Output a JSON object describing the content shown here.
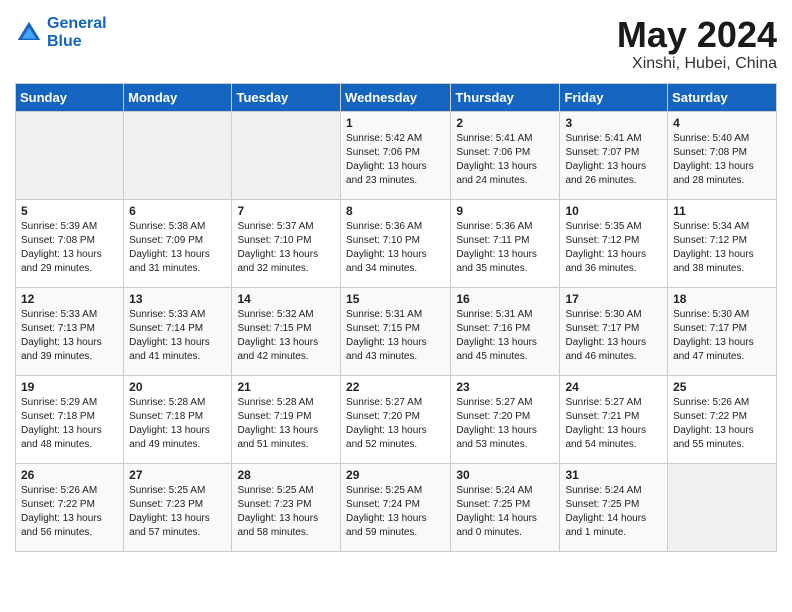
{
  "header": {
    "logo_line1": "General",
    "logo_line2": "Blue",
    "month": "May 2024",
    "location": "Xinshi, Hubei, China"
  },
  "weekdays": [
    "Sunday",
    "Monday",
    "Tuesday",
    "Wednesday",
    "Thursday",
    "Friday",
    "Saturday"
  ],
  "weeks": [
    [
      {
        "day": "",
        "sunrise": "",
        "sunset": "",
        "daylight": ""
      },
      {
        "day": "",
        "sunrise": "",
        "sunset": "",
        "daylight": ""
      },
      {
        "day": "",
        "sunrise": "",
        "sunset": "",
        "daylight": ""
      },
      {
        "day": "1",
        "sunrise": "Sunrise: 5:42 AM",
        "sunset": "Sunset: 7:06 PM",
        "daylight": "Daylight: 13 hours and 23 minutes."
      },
      {
        "day": "2",
        "sunrise": "Sunrise: 5:41 AM",
        "sunset": "Sunset: 7:06 PM",
        "daylight": "Daylight: 13 hours and 24 minutes."
      },
      {
        "day": "3",
        "sunrise": "Sunrise: 5:41 AM",
        "sunset": "Sunset: 7:07 PM",
        "daylight": "Daylight: 13 hours and 26 minutes."
      },
      {
        "day": "4",
        "sunrise": "Sunrise: 5:40 AM",
        "sunset": "Sunset: 7:08 PM",
        "daylight": "Daylight: 13 hours and 28 minutes."
      }
    ],
    [
      {
        "day": "5",
        "sunrise": "Sunrise: 5:39 AM",
        "sunset": "Sunset: 7:08 PM",
        "daylight": "Daylight: 13 hours and 29 minutes."
      },
      {
        "day": "6",
        "sunrise": "Sunrise: 5:38 AM",
        "sunset": "Sunset: 7:09 PM",
        "daylight": "Daylight: 13 hours and 31 minutes."
      },
      {
        "day": "7",
        "sunrise": "Sunrise: 5:37 AM",
        "sunset": "Sunset: 7:10 PM",
        "daylight": "Daylight: 13 hours and 32 minutes."
      },
      {
        "day": "8",
        "sunrise": "Sunrise: 5:36 AM",
        "sunset": "Sunset: 7:10 PM",
        "daylight": "Daylight: 13 hours and 34 minutes."
      },
      {
        "day": "9",
        "sunrise": "Sunrise: 5:36 AM",
        "sunset": "Sunset: 7:11 PM",
        "daylight": "Daylight: 13 hours and 35 minutes."
      },
      {
        "day": "10",
        "sunrise": "Sunrise: 5:35 AM",
        "sunset": "Sunset: 7:12 PM",
        "daylight": "Daylight: 13 hours and 36 minutes."
      },
      {
        "day": "11",
        "sunrise": "Sunrise: 5:34 AM",
        "sunset": "Sunset: 7:12 PM",
        "daylight": "Daylight: 13 hours and 38 minutes."
      }
    ],
    [
      {
        "day": "12",
        "sunrise": "Sunrise: 5:33 AM",
        "sunset": "Sunset: 7:13 PM",
        "daylight": "Daylight: 13 hours and 39 minutes."
      },
      {
        "day": "13",
        "sunrise": "Sunrise: 5:33 AM",
        "sunset": "Sunset: 7:14 PM",
        "daylight": "Daylight: 13 hours and 41 minutes."
      },
      {
        "day": "14",
        "sunrise": "Sunrise: 5:32 AM",
        "sunset": "Sunset: 7:15 PM",
        "daylight": "Daylight: 13 hours and 42 minutes."
      },
      {
        "day": "15",
        "sunrise": "Sunrise: 5:31 AM",
        "sunset": "Sunset: 7:15 PM",
        "daylight": "Daylight: 13 hours and 43 minutes."
      },
      {
        "day": "16",
        "sunrise": "Sunrise: 5:31 AM",
        "sunset": "Sunset: 7:16 PM",
        "daylight": "Daylight: 13 hours and 45 minutes."
      },
      {
        "day": "17",
        "sunrise": "Sunrise: 5:30 AM",
        "sunset": "Sunset: 7:17 PM",
        "daylight": "Daylight: 13 hours and 46 minutes."
      },
      {
        "day": "18",
        "sunrise": "Sunrise: 5:30 AM",
        "sunset": "Sunset: 7:17 PM",
        "daylight": "Daylight: 13 hours and 47 minutes."
      }
    ],
    [
      {
        "day": "19",
        "sunrise": "Sunrise: 5:29 AM",
        "sunset": "Sunset: 7:18 PM",
        "daylight": "Daylight: 13 hours and 48 minutes."
      },
      {
        "day": "20",
        "sunrise": "Sunrise: 5:28 AM",
        "sunset": "Sunset: 7:18 PM",
        "daylight": "Daylight: 13 hours and 49 minutes."
      },
      {
        "day": "21",
        "sunrise": "Sunrise: 5:28 AM",
        "sunset": "Sunset: 7:19 PM",
        "daylight": "Daylight: 13 hours and 51 minutes."
      },
      {
        "day": "22",
        "sunrise": "Sunrise: 5:27 AM",
        "sunset": "Sunset: 7:20 PM",
        "daylight": "Daylight: 13 hours and 52 minutes."
      },
      {
        "day": "23",
        "sunrise": "Sunrise: 5:27 AM",
        "sunset": "Sunset: 7:20 PM",
        "daylight": "Daylight: 13 hours and 53 minutes."
      },
      {
        "day": "24",
        "sunrise": "Sunrise: 5:27 AM",
        "sunset": "Sunset: 7:21 PM",
        "daylight": "Daylight: 13 hours and 54 minutes."
      },
      {
        "day": "25",
        "sunrise": "Sunrise: 5:26 AM",
        "sunset": "Sunset: 7:22 PM",
        "daylight": "Daylight: 13 hours and 55 minutes."
      }
    ],
    [
      {
        "day": "26",
        "sunrise": "Sunrise: 5:26 AM",
        "sunset": "Sunset: 7:22 PM",
        "daylight": "Daylight: 13 hours and 56 minutes."
      },
      {
        "day": "27",
        "sunrise": "Sunrise: 5:25 AM",
        "sunset": "Sunset: 7:23 PM",
        "daylight": "Daylight: 13 hours and 57 minutes."
      },
      {
        "day": "28",
        "sunrise": "Sunrise: 5:25 AM",
        "sunset": "Sunset: 7:23 PM",
        "daylight": "Daylight: 13 hours and 58 minutes."
      },
      {
        "day": "29",
        "sunrise": "Sunrise: 5:25 AM",
        "sunset": "Sunset: 7:24 PM",
        "daylight": "Daylight: 13 hours and 59 minutes."
      },
      {
        "day": "30",
        "sunrise": "Sunrise: 5:24 AM",
        "sunset": "Sunset: 7:25 PM",
        "daylight": "Daylight: 14 hours and 0 minutes."
      },
      {
        "day": "31",
        "sunrise": "Sunrise: 5:24 AM",
        "sunset": "Sunset: 7:25 PM",
        "daylight": "Daylight: 14 hours and 1 minute."
      },
      {
        "day": "",
        "sunrise": "",
        "sunset": "",
        "daylight": ""
      }
    ]
  ]
}
